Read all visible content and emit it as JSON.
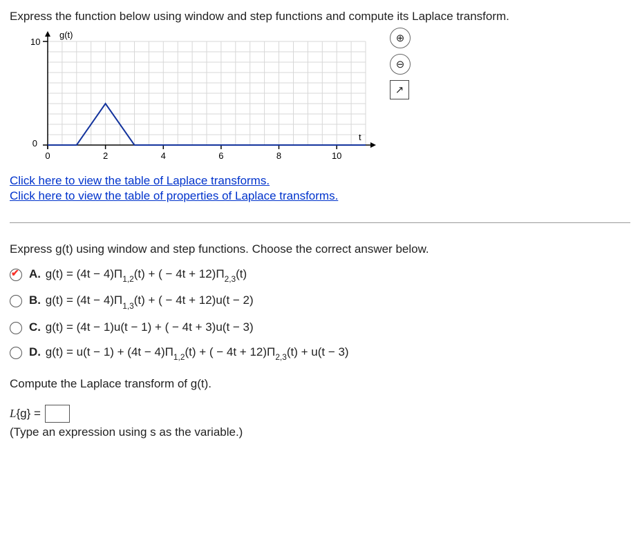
{
  "question": "Express the function below using window and step functions and compute its Laplace transform.",
  "link1": "Click here to view the table of Laplace transforms.",
  "link2": "Click here to view the table of properties of Laplace transforms.",
  "prompt_mc": "Express g(t) using window and step functions. Choose the correct answer below.",
  "options": {
    "A": {
      "letter": "A.",
      "expr_html": "g(t) = (4t − 4)Π<span class='sub-index'>1,2</span>(t) + ( − 4t + 12)Π<span class='sub-index'>2,3</span>(t)"
    },
    "B": {
      "letter": "B.",
      "expr_html": "g(t) = (4t − 4)Π<span class='sub-index'>1,3</span>(t) + ( − 4t + 12)u(t − 2)"
    },
    "C": {
      "letter": "C.",
      "expr_html": "g(t) = (4t − 1)u(t − 1) + ( − 4t + 3)u(t − 3)"
    },
    "D": {
      "letter": "D.",
      "expr_html": "g(t) = u(t − 1) + (4t − 4)Π<span class='sub-index'>1,2</span>(t) + ( − 4t + 12)Π<span class='sub-index'>2,3</span>(t) + u(t − 3)"
    }
  },
  "compute_prompt": "Compute the Laplace transform of g(t).",
  "laplace_label_html": "<span class='laplace-L'>L</span>{g} = ",
  "laplace_input_value": "",
  "answer_note": "(Type an expression using s as the variable.)",
  "chart_data": {
    "type": "line",
    "title": "",
    "xlabel": "t",
    "ylabel": "g(t)",
    "xlim": [
      0,
      11
    ],
    "ylim": [
      0,
      10
    ],
    "xticks": [
      0,
      2,
      4,
      6,
      8,
      10
    ],
    "yticks": [
      0,
      10
    ],
    "series": [
      {
        "name": "g(t)",
        "points": [
          {
            "x": 0,
            "y": 0
          },
          {
            "x": 1,
            "y": 0
          },
          {
            "x": 2,
            "y": 4
          },
          {
            "x": 3,
            "y": 0
          },
          {
            "x": 11,
            "y": 0
          }
        ]
      }
    ],
    "grid": true
  }
}
